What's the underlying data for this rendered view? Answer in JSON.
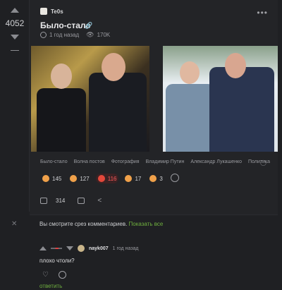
{
  "post": {
    "rating": "4052",
    "author": "Te0s",
    "title": "Было-стало",
    "time_ago": "1 год назад",
    "views": "170K",
    "tags": [
      "Было-стало",
      "Волна постов",
      "Фотография",
      "Владимир Путин",
      "Александр Лукашенко",
      "Политика"
    ],
    "reactions": [
      {
        "count": "145",
        "active": false
      },
      {
        "count": "127",
        "active": false
      },
      {
        "count": "116",
        "active": true
      },
      {
        "count": "17",
        "active": false
      },
      {
        "count": "3",
        "active": false
      }
    ],
    "comments_count": "314"
  },
  "comments": {
    "slice_text": "Вы смотрите срез комментариев.",
    "show_all": "Показать все",
    "items": [
      {
        "author": "nayk007",
        "time": "1 год назад",
        "text": "плохо чтоли?",
        "reply": "ответить"
      }
    ]
  },
  "icons": {
    "upvote": "up-arrow-icon",
    "downvote": "down-arrow-icon",
    "more": "more-dots-icon",
    "link": "link-icon",
    "clock": "clock-icon",
    "views": "eye-icon",
    "tag": "tag-icon",
    "comments": "comment-icon",
    "save": "bookmark-icon",
    "share": "share-icon"
  },
  "colors": {
    "background": "#1f2023",
    "card": "#232427",
    "accent_green": "#6fb03f",
    "reaction_active": "#ff5a5a"
  }
}
